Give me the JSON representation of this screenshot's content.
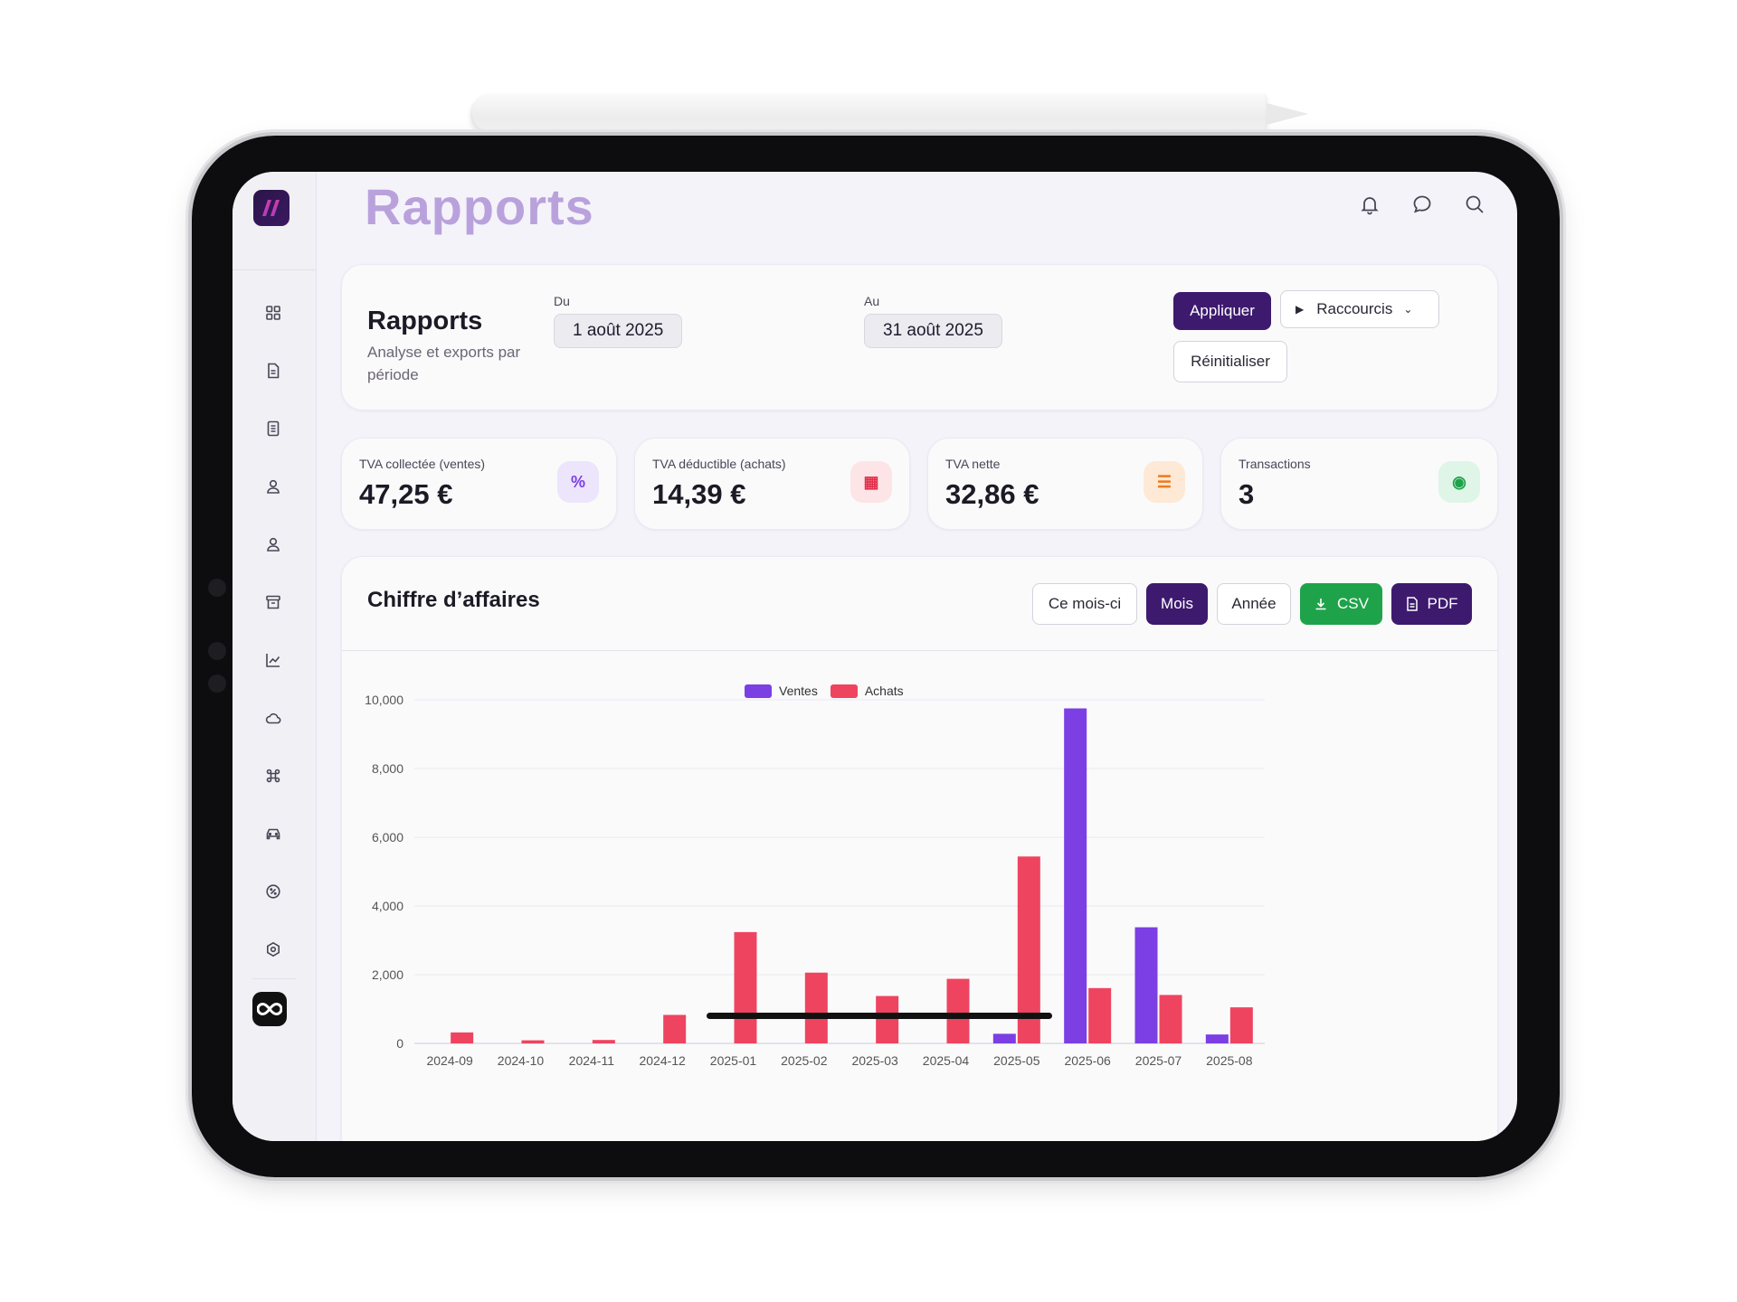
{
  "header": {
    "title": "Rapports"
  },
  "top_icons": [
    "bell-icon",
    "chat-icon",
    "search-icon"
  ],
  "sidebar": {
    "items": [
      {
        "icon": "dashboard-icon"
      },
      {
        "icon": "document-icon"
      },
      {
        "icon": "list-document-icon"
      },
      {
        "icon": "user-icon"
      },
      {
        "icon": "user-icon"
      },
      {
        "icon": "archive-icon"
      },
      {
        "icon": "chart-line-icon"
      },
      {
        "icon": "cloud-icon"
      },
      {
        "icon": "command-icon"
      },
      {
        "icon": "car-icon"
      },
      {
        "icon": "badge-percent-icon"
      },
      {
        "icon": "settings-icon"
      }
    ],
    "bottom_icon": "infinity-icon"
  },
  "filters": {
    "title": "Rapports",
    "subtitle": "Analyse et exports par période",
    "from_label": "Du",
    "from_value": "1 août 2025",
    "to_label": "Au",
    "to_value": "31 août 2025",
    "apply_label": "Appliquer",
    "shortcuts_label": "Raccourcis",
    "reset_label": "Réinitialiser"
  },
  "stats": [
    {
      "label": "TVA collectée (ventes)",
      "value": "47,25 €",
      "icon": "percent-icon",
      "glyph": "%",
      "bg": "#ece5fb",
      "fg": "#7b3fe4"
    },
    {
      "label": "TVA déductible (achats)",
      "value": "14,39 €",
      "icon": "calculator-icon",
      "glyph": "▦",
      "bg": "#fde4e6",
      "fg": "#e0304a"
    },
    {
      "label": "TVA nette",
      "value": "32,86 €",
      "icon": "sliders-icon",
      "glyph": "☰",
      "bg": "#fde9d6",
      "fg": "#ef7a1c"
    },
    {
      "label": "Transactions",
      "value": "3",
      "icon": "money-icon",
      "glyph": "◉",
      "bg": "#dff5e7",
      "fg": "#1fa34a"
    }
  ],
  "chart_card": {
    "title": "Chiffre d’affaires",
    "btn_this_month": "Ce mois-ci",
    "btn_month": "Mois",
    "btn_year": "Année",
    "btn_csv": "CSV",
    "btn_pdf": "PDF"
  },
  "chart_data": {
    "type": "bar",
    "categories": [
      "2024-09",
      "2024-10",
      "2024-11",
      "2024-12",
      "2025-01",
      "2025-02",
      "2025-03",
      "2025-04",
      "2025-05",
      "2025-06",
      "2025-07",
      "2025-08"
    ],
    "series": [
      {
        "name": "Ventes",
        "color": "#7b3fe4",
        "values": [
          0,
          0,
          0,
          0,
          0,
          0,
          0,
          0,
          280,
          9750,
          3380,
          260
        ]
      },
      {
        "name": "Achats",
        "color": "#ee4460",
        "values": [
          320,
          90,
          100,
          830,
          3240,
          2060,
          1380,
          1880,
          5440,
          1610,
          1410,
          1050
        ]
      }
    ],
    "ylim": [
      0,
      10000
    ],
    "yticks": [
      0,
      2000,
      4000,
      6000,
      8000,
      10000
    ],
    "ytick_labels": [
      "0",
      "2,000",
      "4,000",
      "6,000",
      "8,000",
      "10,000"
    ],
    "grid": true,
    "legend": "top-center"
  }
}
